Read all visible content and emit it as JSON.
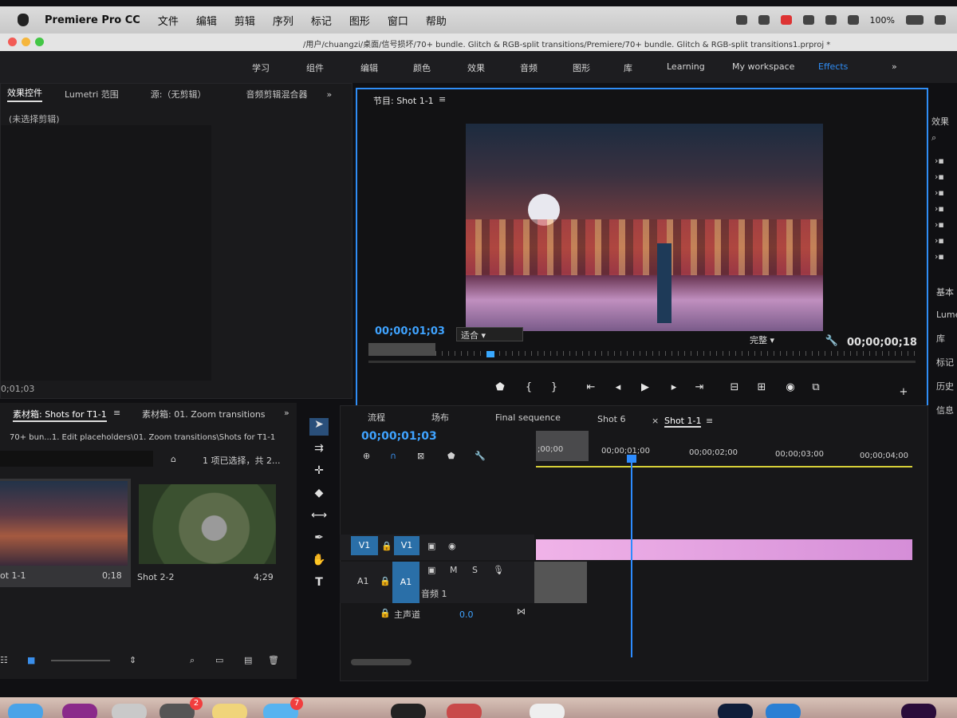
{
  "menubar": {
    "app": "Premiere Pro CC",
    "items": [
      "文件",
      "编辑",
      "剪辑",
      "序列",
      "标记",
      "图形",
      "窗口",
      "帮助"
    ],
    "battery": "100%"
  },
  "titlebar": {
    "path": "/用户/chuangzi/桌面/信号损坏/70+ bundle. Glitch & RGB-split transitions/Premiere/70+ bundle. Glitch & RGB-split transitions1.prproj *"
  },
  "workspaces": [
    "学习",
    "组件",
    "编辑",
    "颜色",
    "效果",
    "音频",
    "图形",
    "库",
    "Learning",
    "My workspace",
    "Effects"
  ],
  "left_panel": {
    "tabs": [
      "效果控件",
      "Lumetri 范围",
      "源:（无剪辑）",
      "音频剪辑混合器"
    ],
    "no_clip": "(未选择剪辑)",
    "timecode": "0;01;03"
  },
  "program": {
    "title": "节目: Shot 1-1",
    "timecode": "00;00;01;03",
    "fit": "适合",
    "quality": "完整",
    "duration": "00;00;00;18"
  },
  "right_panel": {
    "title": "效果",
    "items": [
      "基本",
      "Lume",
      "库",
      "标记",
      "历史",
      "信息"
    ]
  },
  "bin": {
    "tabs": [
      "素材箱: Shots for T1-1",
      "素材箱: 01. Zoom transitions"
    ],
    "path": "70+ bun...1. Edit placeholders\\01. Zoom transitions\\Shots for T1-1",
    "status": "1 项已选择，共 2...",
    "items": [
      {
        "name": "ot 1-1",
        "duration": "0;18"
      },
      {
        "name": "Shot 2-2",
        "duration": "4;29"
      }
    ]
  },
  "timeline": {
    "tabs": [
      "流程",
      "场布",
      "Final sequence",
      "Shot 6",
      "Shot 1-1"
    ],
    "timecode": "00;00;01;03",
    "ruler": [
      ";00;00",
      "00;00;01;00",
      "00;00;02;00",
      "00;00;03;00",
      "00;00;04;00"
    ],
    "v1": "V1",
    "a1": "A1",
    "audio_name": "音频 1",
    "master": "主声道",
    "master_value": "0.0",
    "m": "M",
    "s": "S"
  },
  "dock": {
    "badges": [
      "2",
      "7"
    ]
  }
}
